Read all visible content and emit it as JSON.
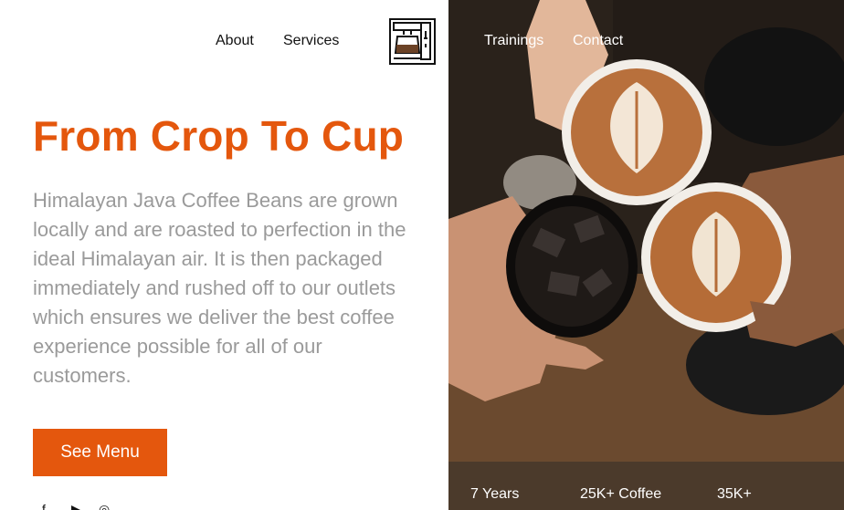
{
  "nav": {
    "about": "About",
    "services": "Services",
    "trainings": "Trainings",
    "contact": "Contact",
    "logo_icon": "coffee-machine-icon"
  },
  "hero": {
    "title": "From Crop To Cup",
    "description": "Himalayan Java Coffee Beans are grown locally and are roasted to perfection in the ideal Himalayan air. It is then packaged immediately and rushed off to our outlets which ensures we deliver the best coffee experience possible for all of our customers.",
    "cta_label": "See Menu"
  },
  "stats": [
    {
      "label": "7 Years"
    },
    {
      "label": "25K+ Coffee"
    },
    {
      "label": "35K+"
    }
  ],
  "social": {
    "icons": [
      "facebook-icon",
      "youtube-icon",
      "instagram-icon"
    ],
    "glyphs": [
      "f",
      "▶",
      "◎"
    ]
  },
  "colors": {
    "accent": "#e4570d",
    "text_muted": "#9a9a9a",
    "stats_bar": "#4b3a2b"
  }
}
